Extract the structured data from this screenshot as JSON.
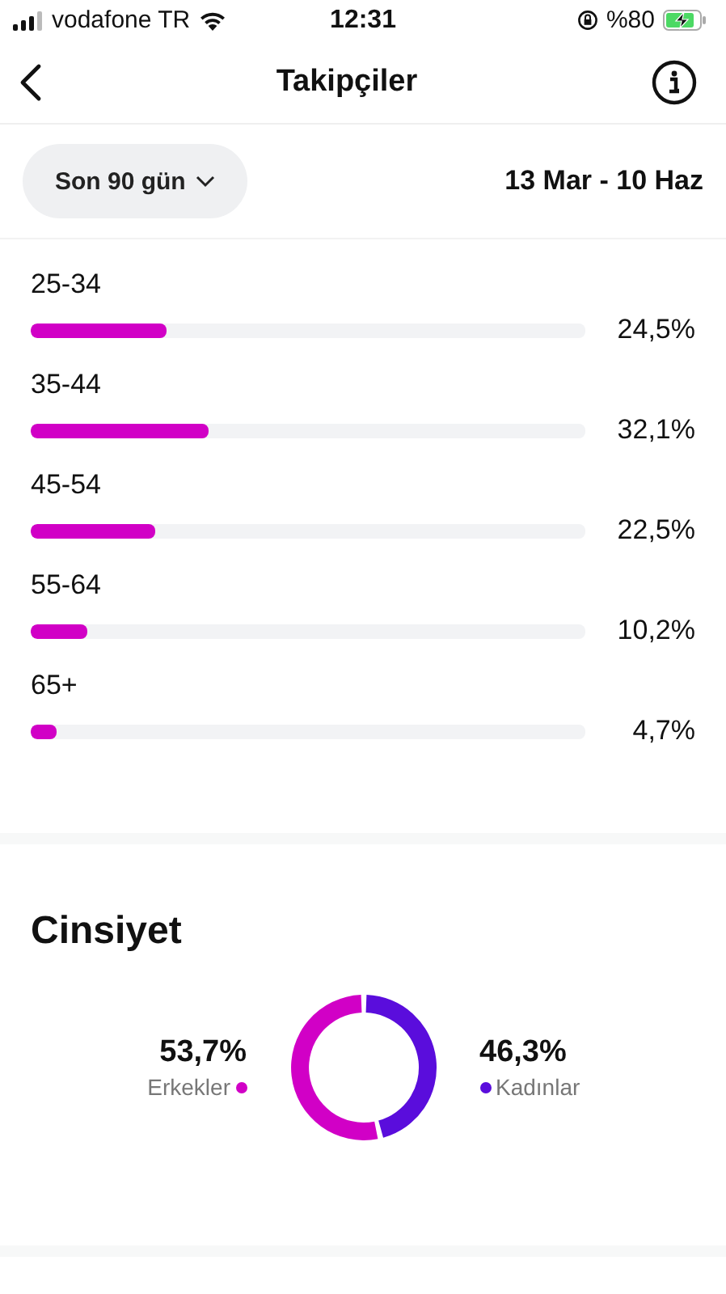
{
  "status_bar": {
    "carrier": "vodafone TR",
    "time": "12:31",
    "battery": "%80"
  },
  "nav": {
    "title": "Takipçiler"
  },
  "filter": {
    "period": "Son 90 gün",
    "range": "13 Mar - 10 Haz"
  },
  "age_groups": [
    {
      "label": "25-34",
      "level": 0.245,
      "reading": "24,5%"
    },
    {
      "label": "35-44",
      "level": 0.321,
      "reading": "32,1%"
    },
    {
      "label": "45-54",
      "level": 0.225,
      "reading": "22,5%"
    },
    {
      "label": "55-64",
      "level": 0.102,
      "reading": "10,2%"
    },
    {
      "label": "65+",
      "level": 0.047,
      "reading": "4,7%"
    }
  ],
  "gender": {
    "title": "Cinsiyet",
    "legend": [
      {
        "color": "#d100c6"
      },
      {
        "color": "#5a0ddc"
      }
    ],
    "chart_data": {
      "type": "donut",
      "categories": [
        "Erkekler",
        "Kadınlar"
      ],
      "values": [
        53.7,
        46.3
      ],
      "value_labels": [
        "53,7%",
        "46,3%"
      ]
    }
  }
}
